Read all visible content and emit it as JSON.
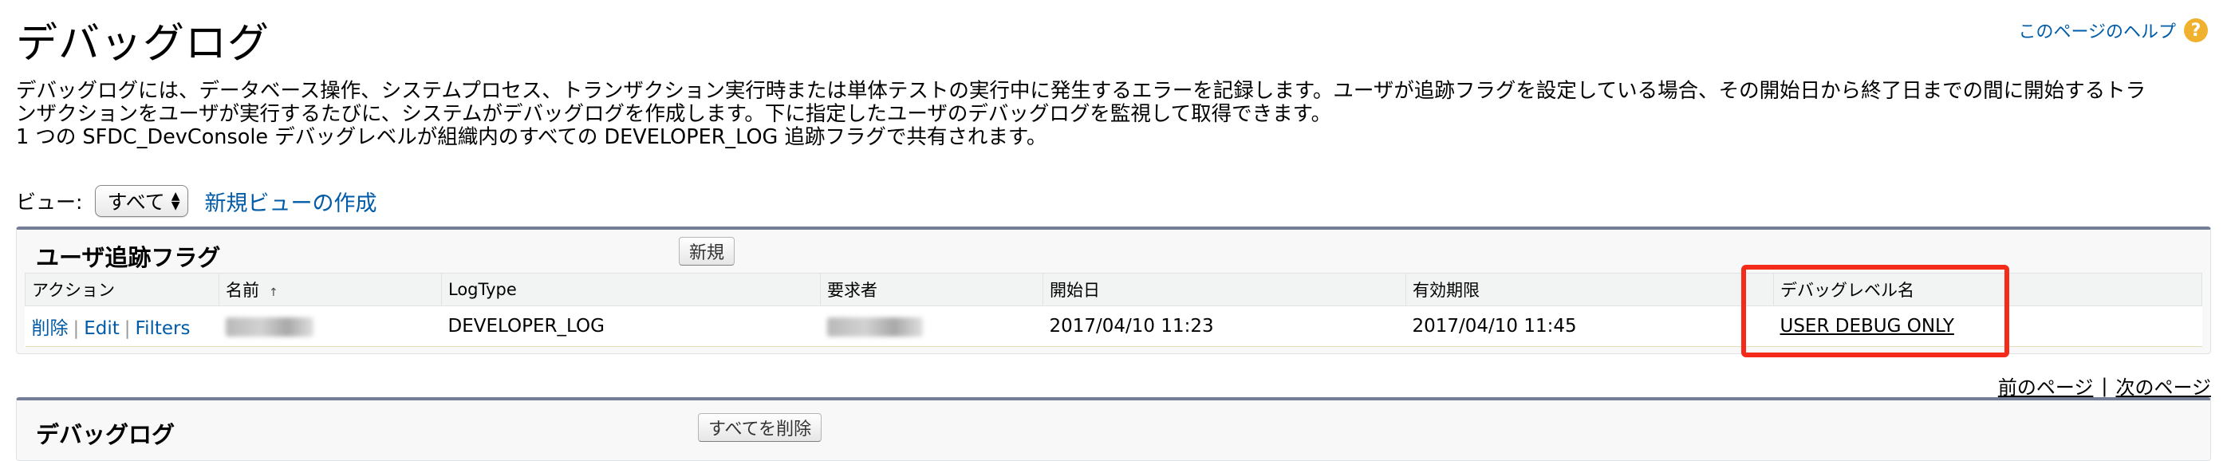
{
  "page": {
    "title": "デバッグログ",
    "help_link": "このページのヘルプ",
    "help_icon": "question-icon",
    "description_lines": [
      "デバッグログには、データベース操作、システムプロセス、トランザクション実行時または単体テストの実行中に発生するエラーを記録します。ユーザが追跡フラグを設定している場合、その開始日から終了日までの間に開始するトラ",
      "ンザクションをユーザが実行するたびに、システムがデバッグログを作成します。下に指定したユーザのデバッグログを監視して取得できます。",
      "1 つの SFDC_DevConsole デバッグレベルが組織内のすべての DEVELOPER_LOG 追跡フラグで共有されます。"
    ]
  },
  "view_bar": {
    "label": "ビュー:",
    "selected": "すべて",
    "create_link": "新規ビューの作成"
  },
  "trace_flags": {
    "title": "ユーザ追跡フラグ",
    "new_button": "新規",
    "columns": [
      "アクション",
      "名前",
      "LogType",
      "要求者",
      "開始日",
      "有効期限",
      "デバッグレベル名"
    ],
    "sort_indicator": "↑",
    "rows": [
      {
        "actions": [
          "削除",
          "Edit",
          "Filters"
        ],
        "name": "",
        "log_type": "DEVELOPER_LOG",
        "requested_by": "",
        "start_date": "2017/04/10 11:23",
        "expiration": "2017/04/10 11:45",
        "debug_level": "USER DEBUG ONLY"
      }
    ]
  },
  "pager": {
    "prev": "前のページ",
    "separator": "|",
    "next": "次のページ"
  },
  "debug_logs": {
    "title": "デバッグログ",
    "delete_all_button": "すべてを削除"
  },
  "colors": {
    "link": "#015ba7",
    "highlight": "#f42b1a",
    "panel_border": "#747e96",
    "help_icon": "#f0b22e"
  }
}
